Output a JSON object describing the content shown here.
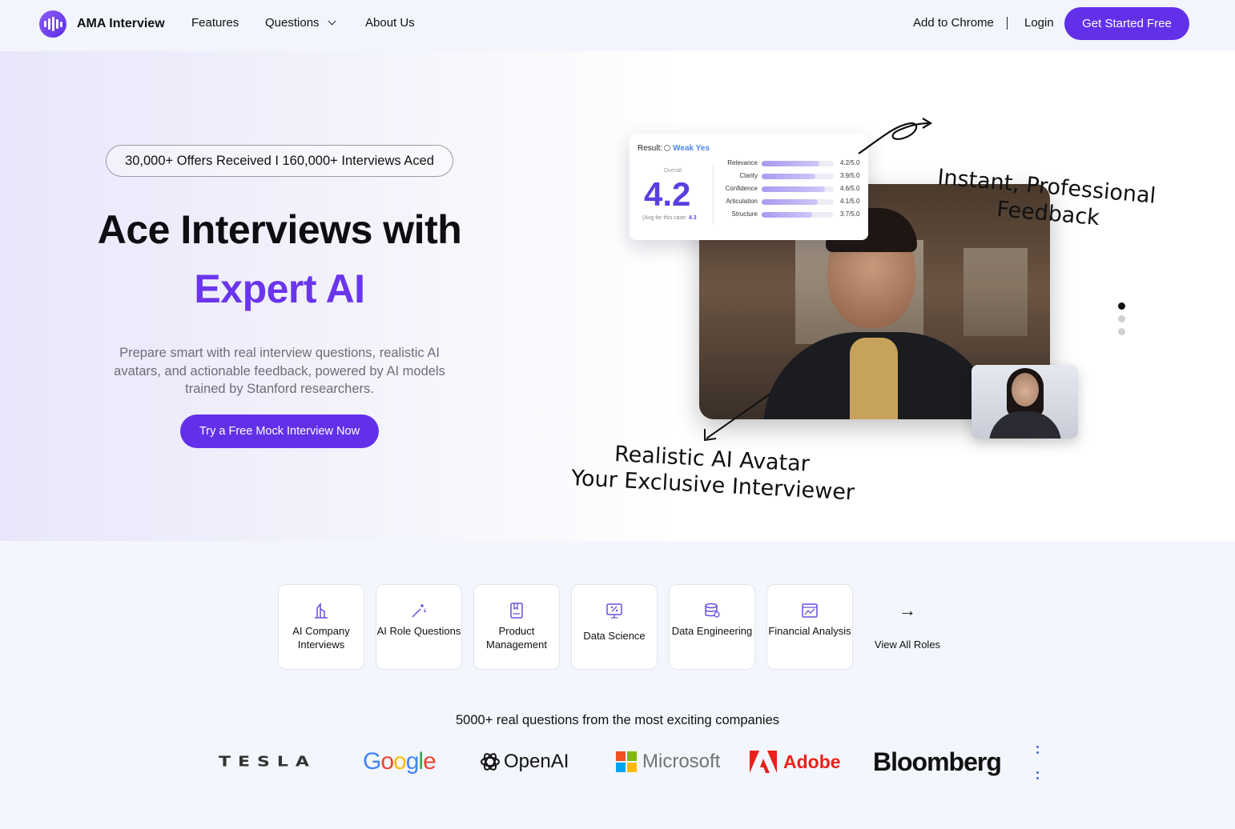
{
  "nav": {
    "brand": "AMA Interview",
    "links": [
      "Features",
      "Questions",
      "About Us"
    ],
    "add_to_chrome": "Add to Chrome",
    "login": "Login",
    "cta": "Get Started Free"
  },
  "hero": {
    "badge": "30,000+ Offers Received I 160,000+ Interviews Aced",
    "title_line1": "Ace Interviews with",
    "title_line2": "Expert AI",
    "lead": "Prepare smart with real interview questions, realistic AI avatars, and actionable feedback, powered by AI models trained by Stanford researchers.",
    "cta": "Try a Free Mock Interview Now",
    "annotation_top_1": "Instant, Professional",
    "annotation_top_2": "Feedback",
    "annotation_bottom_1": "Realistic AI Avatar",
    "annotation_bottom_2": "Your Exclusive Interviewer",
    "carousel_active_index": 0,
    "carousel_count": 3
  },
  "result_card": {
    "label": "Result:",
    "verdict": "Weak Yes",
    "overall_label": "Overall",
    "overall_score": "4.2",
    "avg_label": "(Avg for this case:",
    "avg_value": "4.3",
    "metrics": [
      {
        "name": "Relevance",
        "value": "4.2/5.0",
        "score": 4.2
      },
      {
        "name": "Clarity",
        "value": "3.9/5.0",
        "score": 3.9
      },
      {
        "name": "Confidence",
        "value": "4.6/5.0",
        "score": 4.6
      },
      {
        "name": "Articulation",
        "value": "4.1/5.0",
        "score": 4.1
      },
      {
        "name": "Structure",
        "value": "3.7/5.0",
        "score": 3.7
      }
    ]
  },
  "roles": {
    "items": [
      {
        "label": "AI Company Interviews",
        "icon": "building-icon"
      },
      {
        "label": "AI Role Questions",
        "icon": "magic-wand-icon"
      },
      {
        "label": "Product Management",
        "icon": "book-icon"
      },
      {
        "label": "Data Science",
        "icon": "monitor-percent-icon"
      },
      {
        "label": "Data Engineering",
        "icon": "database-icon"
      },
      {
        "label": "Financial Analysis",
        "icon": "chart-window-icon"
      }
    ],
    "view_all": "View All Roles"
  },
  "companies": {
    "tagline": "5000+ real questions from the most exciting companies",
    "logos": [
      "TESLA",
      "Google",
      "OpenAI",
      "Microsoft",
      "Adobe",
      "Bloomberg"
    ]
  },
  "colors": {
    "accent": "#6230e8",
    "accent_text": "#6b35ec"
  }
}
